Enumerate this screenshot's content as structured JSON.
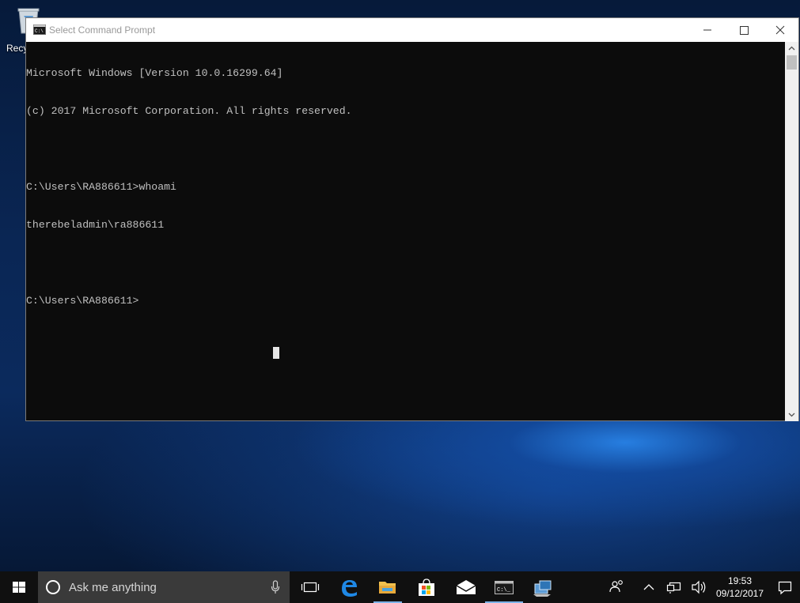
{
  "desktop": {
    "recycle_bin_label": "Recy"
  },
  "window": {
    "title": "Select Command Prompt",
    "console_lines": [
      "Microsoft Windows [Version 10.0.16299.64]",
      "(c) 2017 Microsoft Corporation. All rights reserved.",
      "",
      "C:\\Users\\RA886611>whoami",
      "therebeladmin\\ra886611",
      "",
      "C:\\Users\\RA886611>"
    ]
  },
  "taskbar": {
    "search_placeholder": "Ask me anything",
    "apps": [
      "task-view-icon",
      "edge-icon",
      "file-explorer-icon",
      "store-icon",
      "mail-icon",
      "command-prompt-icon",
      "server-manager-icon"
    ],
    "clock": {
      "time": "19:53",
      "date": "09/12/2017"
    }
  },
  "colors": {
    "console_bg": "#0c0c0c",
    "console_text": "#c0c0c0",
    "taskbar_bg": "#101010",
    "accent": "#7cb3e8"
  }
}
